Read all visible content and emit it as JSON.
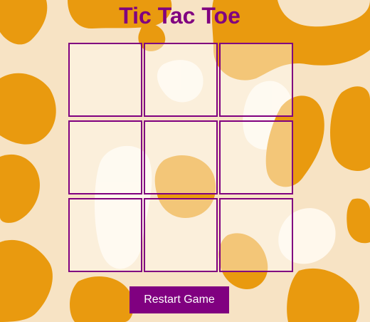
{
  "game": {
    "title": "Tic Tac Toe",
    "board": [
      "",
      "",
      "",
      "",
      "",
      "",
      "",
      "",
      ""
    ],
    "restart_label": "Restart Game"
  },
  "theme": {
    "accent": "#800080",
    "spot_color": "#e99a0f",
    "background": "#f7e3c4",
    "highlight": "#fffaf1"
  }
}
